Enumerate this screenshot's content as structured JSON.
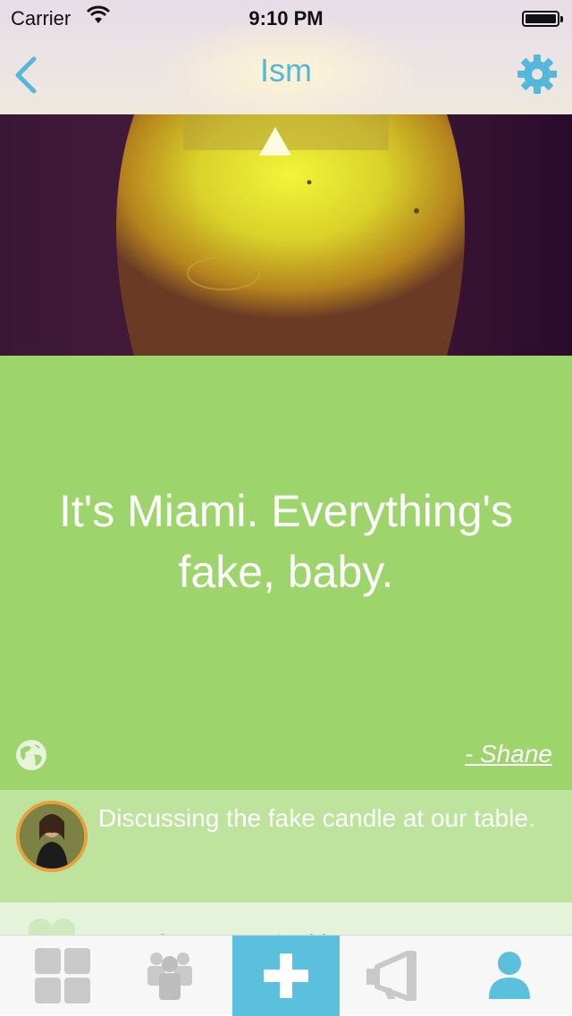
{
  "status_bar": {
    "carrier": "Carrier",
    "time": "9:10 PM",
    "battery_level": 1.0
  },
  "nav": {
    "title": "Ism",
    "back_icon": "chevron-left-icon",
    "settings_icon": "gear-icon"
  },
  "quote": {
    "text": "It's Miami. Everything's fake, baby.",
    "author": "- Shane",
    "visibility_icon": "globe-icon"
  },
  "comment": {
    "text": "Discussing the fake candle at our table."
  },
  "likes": {
    "icon": "heart-icon",
    "names": "Jonathan, Matt Smith"
  },
  "tabbar": {
    "tabs": [
      {
        "icon": "grid-icon",
        "active": false
      },
      {
        "icon": "group-icon",
        "active": false
      },
      {
        "icon": "plus-icon",
        "active": true
      },
      {
        "icon": "megaphone-icon",
        "active": false
      },
      {
        "icon": "profile-icon",
        "active": false
      }
    ]
  },
  "colors": {
    "accent": "#53b8dc",
    "quote_bg": "#9dd56c",
    "comment_bg": "#bde39d",
    "tab_active": "#5bbfde"
  }
}
